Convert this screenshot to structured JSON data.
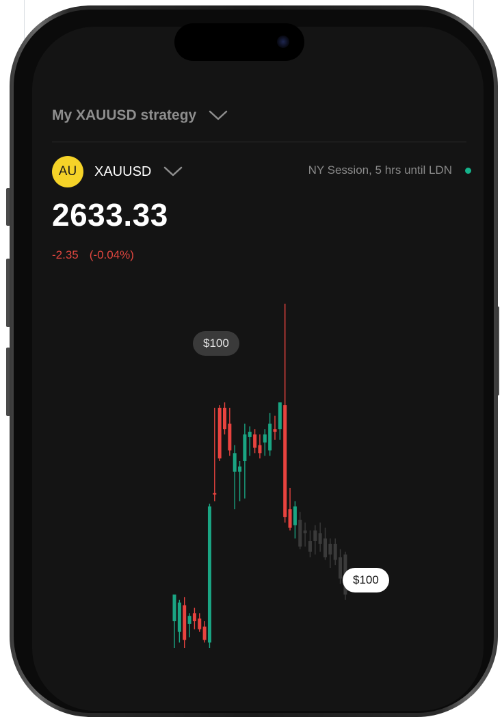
{
  "header": {
    "strategy_title": "My XAUUSD strategy"
  },
  "instrument": {
    "badge": "AU",
    "symbol": "XAUUSD",
    "session_status": "NY Session, 5 hrs until LDN",
    "price": "2633.33",
    "change_abs": "-2.35",
    "change_pct": "(-0.04%)"
  },
  "chart": {
    "upper_marker": "$100",
    "lower_marker": "$100"
  },
  "colors": {
    "bull": "#1aa583",
    "bear": "#e9433f",
    "projected": "#3a3a3a",
    "badge": "#f5d328",
    "live_dot": "#15b38b"
  },
  "chart_data": {
    "type": "candlestick",
    "candles": [
      {
        "o": 0.1,
        "h": 0.2,
        "l": 0.0,
        "c": 0.2,
        "d": "up"
      },
      {
        "o": 0.06,
        "h": 0.18,
        "l": 0.02,
        "c": 0.17,
        "d": "up"
      },
      {
        "o": 0.16,
        "h": 0.19,
        "l": 0.0,
        "c": 0.03,
        "d": "down"
      },
      {
        "o": 0.09,
        "h": 0.13,
        "l": 0.04,
        "c": 0.12,
        "d": "up"
      },
      {
        "o": 0.13,
        "h": 0.15,
        "l": 0.07,
        "c": 0.1,
        "d": "down"
      },
      {
        "o": 0.11,
        "h": 0.13,
        "l": 0.06,
        "c": 0.07,
        "d": "down"
      },
      {
        "o": 0.08,
        "h": 0.1,
        "l": 0.02,
        "c": 0.03,
        "d": "down"
      },
      {
        "o": 0.02,
        "h": 0.54,
        "l": 0.0,
        "c": 0.53,
        "d": "up"
      },
      {
        "o": 0.58,
        "h": 0.9,
        "l": 0.55,
        "c": 0.58,
        "d": "down"
      },
      {
        "o": 0.9,
        "h": 0.91,
        "l": 0.7,
        "c": 0.71,
        "d": "down"
      },
      {
        "o": 0.9,
        "h": 0.92,
        "l": 0.8,
        "c": 0.82,
        "d": "down"
      },
      {
        "o": 0.84,
        "h": 0.9,
        "l": 0.72,
        "c": 0.74,
        "d": "down"
      },
      {
        "o": 0.66,
        "h": 0.76,
        "l": 0.52,
        "c": 0.73,
        "d": "up"
      },
      {
        "o": 0.66,
        "h": 0.7,
        "l": 0.55,
        "c": 0.68,
        "d": "up"
      },
      {
        "o": 0.7,
        "h": 0.84,
        "l": 0.56,
        "c": 0.8,
        "d": "up"
      },
      {
        "o": 0.79,
        "h": 0.83,
        "l": 0.72,
        "c": 0.81,
        "d": "up"
      },
      {
        "o": 0.8,
        "h": 0.82,
        "l": 0.73,
        "c": 0.75,
        "d": "down"
      },
      {
        "o": 0.76,
        "h": 0.8,
        "l": 0.71,
        "c": 0.73,
        "d": "down"
      },
      {
        "o": 0.77,
        "h": 0.82,
        "l": 0.72,
        "c": 0.8,
        "d": "up"
      },
      {
        "o": 0.74,
        "h": 0.88,
        "l": 0.72,
        "c": 0.84,
        "d": "up"
      },
      {
        "o": 0.82,
        "h": 0.87,
        "l": 0.78,
        "c": 0.81,
        "d": "down"
      },
      {
        "o": 0.82,
        "h": 0.92,
        "l": 0.78,
        "c": 0.92,
        "d": "up"
      },
      {
        "o": 0.91,
        "h": 1.29,
        "l": 0.47,
        "c": 0.49,
        "d": "down"
      },
      {
        "o": 0.52,
        "h": 0.6,
        "l": 0.44,
        "c": 0.45,
        "d": "down"
      },
      {
        "o": 0.46,
        "h": 0.55,
        "l": 0.41,
        "c": 0.53,
        "d": "up"
      },
      {
        "o": 0.48,
        "h": 0.51,
        "l": 0.37,
        "c": 0.38,
        "d": "proj"
      },
      {
        "o": 0.44,
        "h": 0.47,
        "l": 0.38,
        "c": 0.43,
        "d": "proj"
      },
      {
        "o": 0.4,
        "h": 0.44,
        "l": 0.34,
        "c": 0.36,
        "d": "proj"
      },
      {
        "o": 0.4,
        "h": 0.46,
        "l": 0.35,
        "c": 0.44,
        "d": "proj"
      },
      {
        "o": 0.43,
        "h": 0.47,
        "l": 0.36,
        "c": 0.39,
        "d": "proj"
      },
      {
        "o": 0.41,
        "h": 0.45,
        "l": 0.33,
        "c": 0.34,
        "d": "proj"
      },
      {
        "o": 0.35,
        "h": 0.41,
        "l": 0.3,
        "c": 0.39,
        "d": "proj"
      },
      {
        "o": 0.39,
        "h": 0.41,
        "l": 0.31,
        "c": 0.33,
        "d": "proj"
      },
      {
        "o": 0.34,
        "h": 0.37,
        "l": 0.24,
        "c": 0.26,
        "d": "proj"
      },
      {
        "o": 0.35,
        "h": 0.36,
        "l": 0.18,
        "c": 0.2,
        "d": "proj"
      }
    ]
  }
}
